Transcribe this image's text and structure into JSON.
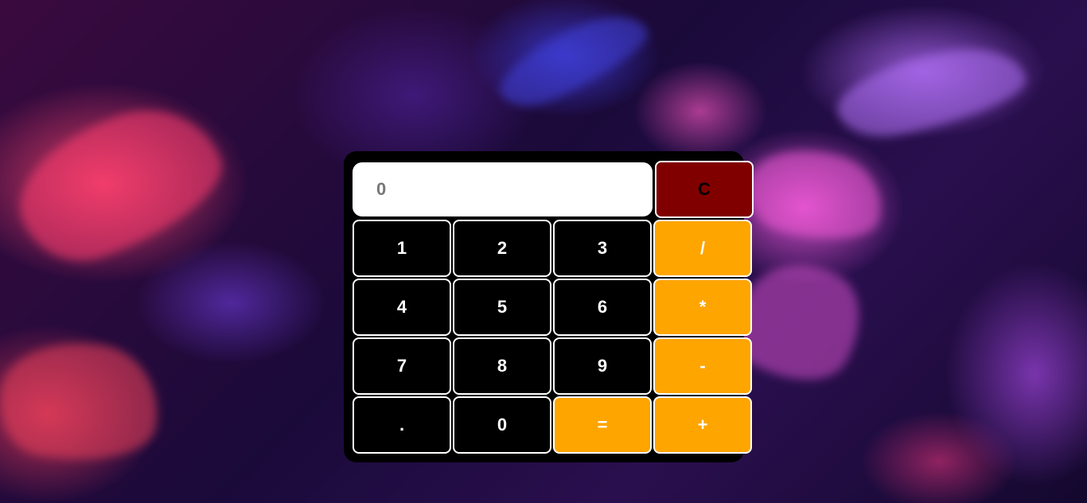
{
  "calculator": {
    "display_value": "0",
    "clear_label": "C",
    "keys": {
      "k1": "1",
      "k2": "2",
      "k3": "3",
      "div": "/",
      "k4": "4",
      "k5": "5",
      "k6": "6",
      "mul": "*",
      "k7": "7",
      "k8": "8",
      "k9": "9",
      "sub": "-",
      "dot": ".",
      "k0": "0",
      "eq": "=",
      "add": "+"
    }
  },
  "colors": {
    "operator": "#ffa500",
    "clear": "#800000",
    "digit": "#000000",
    "display": "#ffffff"
  }
}
